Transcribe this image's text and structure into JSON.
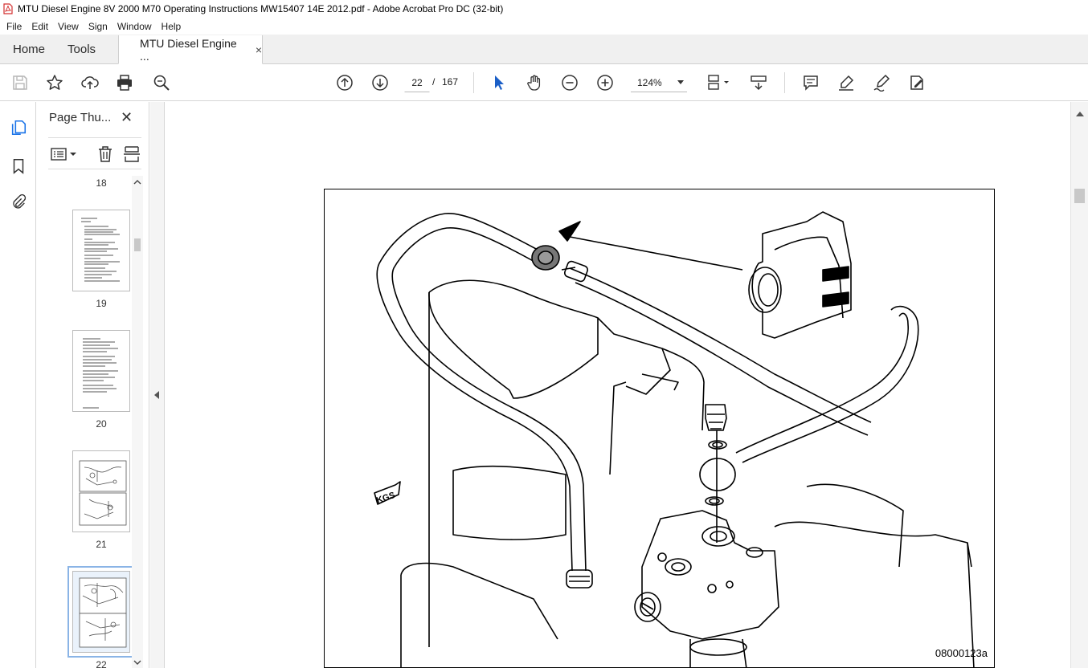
{
  "window": {
    "title": "MTU Diesel Engine 8V 2000 M70 Operating Instructions MW15407 14E 2012.pdf - Adobe Acrobat Pro DC (32-bit)"
  },
  "menu": {
    "items": [
      "File",
      "Edit",
      "View",
      "Sign",
      "Window",
      "Help"
    ]
  },
  "tabs": {
    "home": "Home",
    "tools": "Tools",
    "document": "MTU Diesel Engine ...",
    "close_glyph": "×"
  },
  "toolbar": {
    "current_page": "22",
    "page_separator": "/",
    "total_pages": "167",
    "zoom": "124%"
  },
  "icons": {
    "toolbar": [
      "save-icon",
      "bookmark-star-icon",
      "upload-cloud-icon",
      "print-icon",
      "zoom-search-icon",
      "page-up-icon",
      "page-down-icon",
      "select-arrow-icon",
      "hand-icon",
      "zoom-out-icon",
      "zoom-in-icon",
      "page-display-icon",
      "scroll-mode-icon",
      "comment-icon",
      "highlight-pen-icon",
      "sign-pen-icon",
      "fill-sign-icon"
    ],
    "rail": [
      "thumbnails-icon",
      "bookmarks-icon",
      "attachments-icon"
    ]
  },
  "colors": {
    "accent": "#1a73e8",
    "select_icon": "#1b5fc7"
  },
  "thumbnail_panel": {
    "title": "Page Thu...",
    "close_glyph": "✕",
    "pages": [
      {
        "label": "18",
        "selected": false
      },
      {
        "label": "19",
        "selected": false
      },
      {
        "label": "20",
        "selected": false
      },
      {
        "label": "21",
        "selected": false
      },
      {
        "label": "22",
        "selected": true
      }
    ]
  },
  "document": {
    "figure_code": "08000123a",
    "label_kgs": "KGS"
  }
}
